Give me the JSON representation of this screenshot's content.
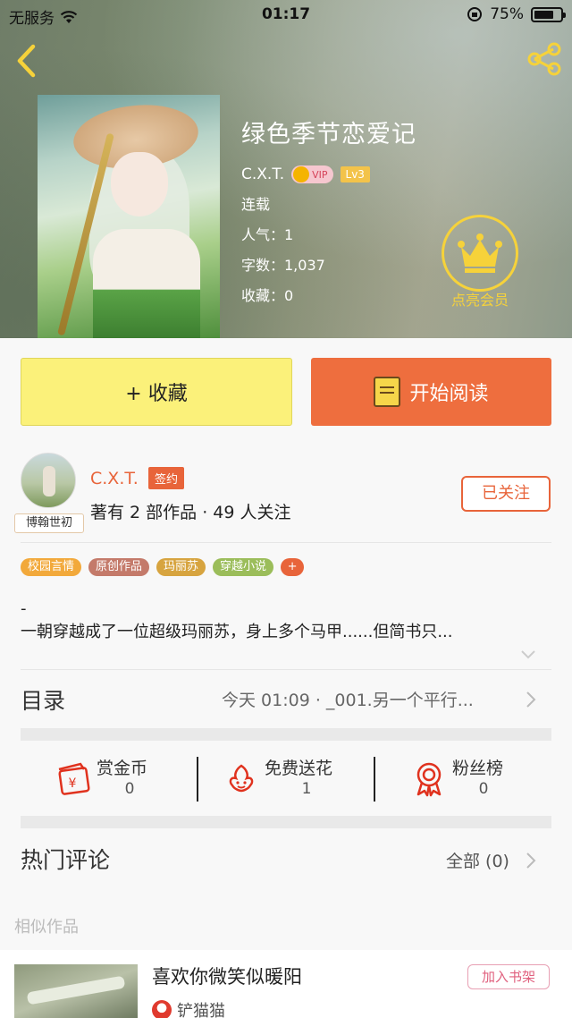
{
  "status_bar": {
    "carrier": "无服务",
    "time": "01:17",
    "battery_percent": "75%",
    "battery_level": 0.75
  },
  "book": {
    "title": "绿色季节恋爱记",
    "author": "C.X.T.",
    "vip_label": "VIP",
    "level": "Lv3",
    "status": "连载",
    "popularity": "人气：1",
    "word_count": "字数：1,037",
    "favorites": "收藏：0"
  },
  "member": {
    "label": "点亮会员"
  },
  "actions": {
    "collect_label": "+ 收藏",
    "read_label": "开始阅读"
  },
  "author_section": {
    "avatar_tag": "博翰世初",
    "name": "C.X.T.",
    "sign_badge": "签约",
    "meta": "著有 2 部作品 · 49 人关注",
    "follow_label": "已关注"
  },
  "tags": [
    {
      "label": "校园言情",
      "color": "#f2a93b"
    },
    {
      "label": "原创作品",
      "color": "#c47a6a"
    },
    {
      "label": "玛丽苏",
      "color": "#d7a43f"
    },
    {
      "label": "穿越小说",
      "color": "#9bbd5a"
    }
  ],
  "tag_more": "+",
  "synopsis": {
    "line1": "-",
    "line2": "一朝穿越成了一位超级玛丽苏，身上多个马甲......但简书只..."
  },
  "catalog": {
    "title": "目录",
    "latest": "今天 01:09 · _001.另一个平行..."
  },
  "rewards": [
    {
      "icon": "red-envelope-icon",
      "label": "赏金币",
      "count": "0"
    },
    {
      "icon": "flower-icon",
      "label": "免费送花",
      "count": "1"
    },
    {
      "icon": "medal-icon",
      "label": "粉丝榜",
      "count": "0"
    }
  ],
  "comments": {
    "title": "热门评论",
    "all_label": "全部 (0)"
  },
  "similar": {
    "section_title": "相似作品",
    "items": [
      {
        "title": "喜欢你微笑似暖阳",
        "author": "铲猫猫",
        "button": "加入书架"
      }
    ]
  },
  "colors": {
    "accent": "#e8643a",
    "collect_bg": "#fbf17a",
    "read_bg": "#ee6e3e",
    "gold": "#f6d23a"
  }
}
